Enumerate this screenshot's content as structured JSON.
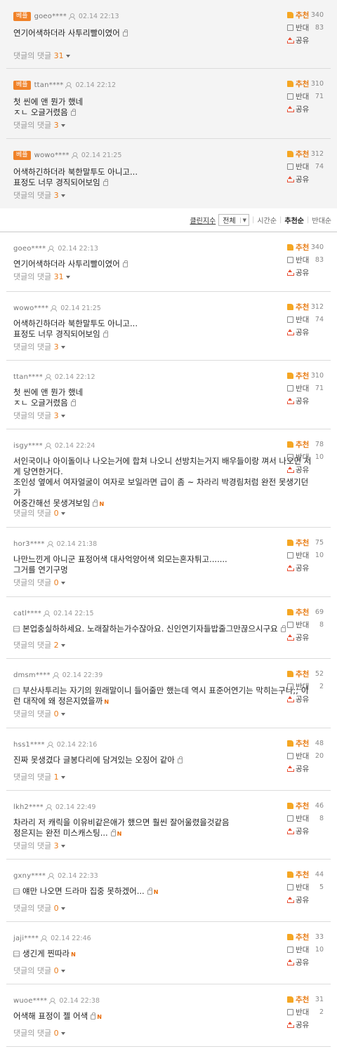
{
  "labels": {
    "best_badge": "베플",
    "reply_prefix": "댓글의 댓글",
    "upvote": "추천",
    "downvote": "반대",
    "share": "공유",
    "new_badge": "N"
  },
  "best_comments": [
    {
      "nick": "goeo****",
      "date": "02.14 22:13",
      "lines": [
        "연기어색하더라 사투리빨이였어"
      ],
      "replies": "31",
      "up": "340",
      "down": "83"
    },
    {
      "nick": "ttan****",
      "date": "02.14 22:12",
      "lines": [
        "첫 씬에 앤 뭔가 했네",
        "ㅈㄴ 오글거렸음"
      ],
      "replies": "3",
      "up": "310",
      "down": "71"
    },
    {
      "nick": "wowo****",
      "date": "02.14 21:25",
      "lines": [
        "어색하긴하더라 북한말투도 아니고...",
        "표정도 너무 경직되어보임"
      ],
      "replies": "3",
      "up": "312",
      "down": "74"
    }
  ],
  "sortbar": {
    "cleanbot": "클린지수",
    "filter_value": "전체",
    "filter_arrow": "▼",
    "sort_time": "시간순",
    "sort_up": "추천순",
    "sort_down": "반대순"
  },
  "comments": [
    {
      "nick": "goeo****",
      "date": "02.14 22:13",
      "lines": [
        "연기어색하더라 사투리빨이였어"
      ],
      "replies": "31",
      "up": "340",
      "down": "83"
    },
    {
      "nick": "wowo****",
      "date": "02.14 21:25",
      "lines": [
        "어색하긴하더라 북한말투도 아니고...",
        "표정도 너무 경직되어보임"
      ],
      "replies": "3",
      "up": "312",
      "down": "74"
    },
    {
      "nick": "ttan****",
      "date": "02.14 22:12",
      "lines": [
        "첫 씬에 앤 뭔가 했네",
        "ㅈㄴ 오글거렸음"
      ],
      "replies": "3",
      "up": "310",
      "down": "71"
    },
    {
      "nick": "isgy****",
      "date": "02.14 22:24",
      "lines": [
        "서인국이나 아이돌이나 나오는거에 합쳐 나오니 선방치는거지 배우들이랑 껴서 나오면 저",
        "게 당연한거다.",
        "조인성 옆에서 여자얼굴이 여자로 보일라면 급이 좀 ~ 차라리 박경림처럼 완전 못생기던",
        "가",
        "어중간해선 못생겨보임"
      ],
      "replies": "0",
      "up": "78",
      "down": "10"
    },
    {
      "nick": "hor3****",
      "date": "02.14 21:38",
      "lines": [
        "나만느낀게 아니군 표정어색 대사억양어색 외모는혼자튀고.......",
        "그거를 연기구멍"
      ],
      "replies": "0",
      "up": "75",
      "down": "10"
    },
    {
      "nick": "catl****",
      "date": "02.14 22:15",
      "lines": [
        "본업충실하하세요. 노래잘하는가수잖아요. 신인연기자들밥줄그만끊으시구요"
      ],
      "replies": "2",
      "up": "69",
      "down": "8"
    },
    {
      "nick": "dmsm****",
      "date": "02.14 22:39",
      "lines": [
        "부산사투리는 자기의 원래말이니 들어줄만 했는데 역시 표준어연기는 막히는구나;; 이",
        "런 대작에 왜 정은지였을까"
      ],
      "replies": "0",
      "up": "52",
      "down": "2"
    },
    {
      "nick": "hss1****",
      "date": "02.14 22:16",
      "lines": [
        "진짜 못생겼다 글봉다리에 담겨있는 오징어 같아"
      ],
      "replies": "1",
      "up": "48",
      "down": "20"
    },
    {
      "nick": "lkh2****",
      "date": "02.14 22:49",
      "lines": [
        "차라리 저 캐릭을 이유비같은애가 했으면 훨씬 잘어울렸을것같음",
        "정은지는 완전 미스캐스팅..."
      ],
      "replies": "3",
      "up": "46",
      "down": "8"
    },
    {
      "nick": "gxny****",
      "date": "02.14 22:33",
      "lines": [
        "얘만 나오면 드라마 집중 못하겠어..."
      ],
      "replies": "0",
      "up": "44",
      "down": "5"
    },
    {
      "nick": "jaji****",
      "date": "02.14 22:46",
      "lines": [
        "생긴게 찐따라"
      ],
      "replies": "0",
      "up": "33",
      "down": "10"
    },
    {
      "nick": "wuoe****",
      "date": "02.14 22:38",
      "lines": [
        "어색해 표정이 젤 어색"
      ],
      "replies": "0",
      "up": "31",
      "down": "2"
    }
  ]
}
